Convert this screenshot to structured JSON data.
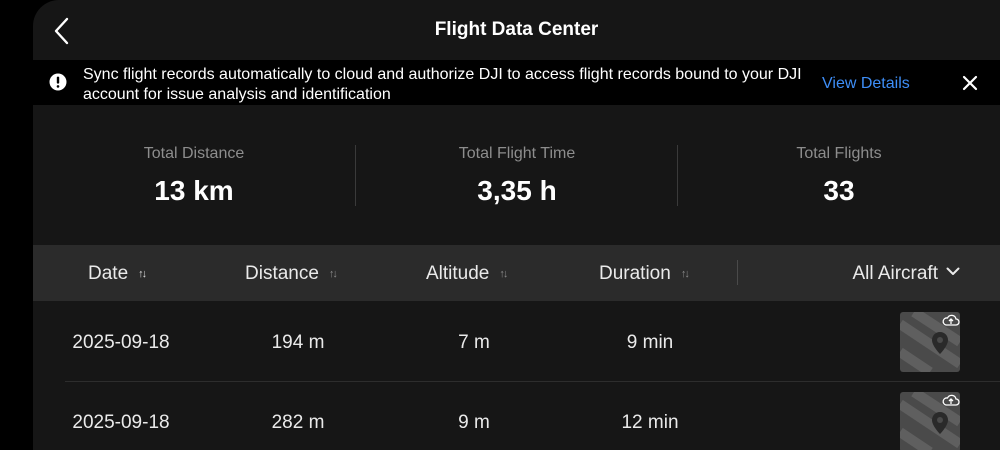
{
  "header": {
    "title": "Flight Data Center"
  },
  "notice": {
    "text": "Sync flight records automatically to cloud and authorize DJI to access flight records bound to your DJI account for issue analysis and identification",
    "link": "View Details"
  },
  "stats": [
    {
      "label": "Total Distance",
      "value": "13 km"
    },
    {
      "label": "Total Flight Time",
      "value": "3,35 h"
    },
    {
      "label": "Total Flights",
      "value": "33"
    }
  ],
  "table": {
    "columns": [
      {
        "label": "Date",
        "sort_active": true
      },
      {
        "label": "Distance",
        "sort_active": false
      },
      {
        "label": "Altitude",
        "sort_active": false
      },
      {
        "label": "Duration",
        "sort_active": false
      }
    ],
    "filter_label": "All Aircraft",
    "rows": [
      {
        "date": "2025-09-18",
        "distance": "194 m",
        "altitude": "7 m",
        "duration": "9 min"
      },
      {
        "date": "2025-09-18",
        "distance": "282 m",
        "altitude": "9 m",
        "duration": "12 min"
      }
    ]
  },
  "colors": {
    "accent": "#3e8ef7",
    "background": "#161616",
    "table_header": "#2b2b2b"
  },
  "icons": [
    "back-chevron-icon",
    "exclamation-circle-icon",
    "close-icon",
    "sort-icon",
    "chevron-down-icon",
    "map-pin-icon",
    "cloud-upload-icon"
  ]
}
